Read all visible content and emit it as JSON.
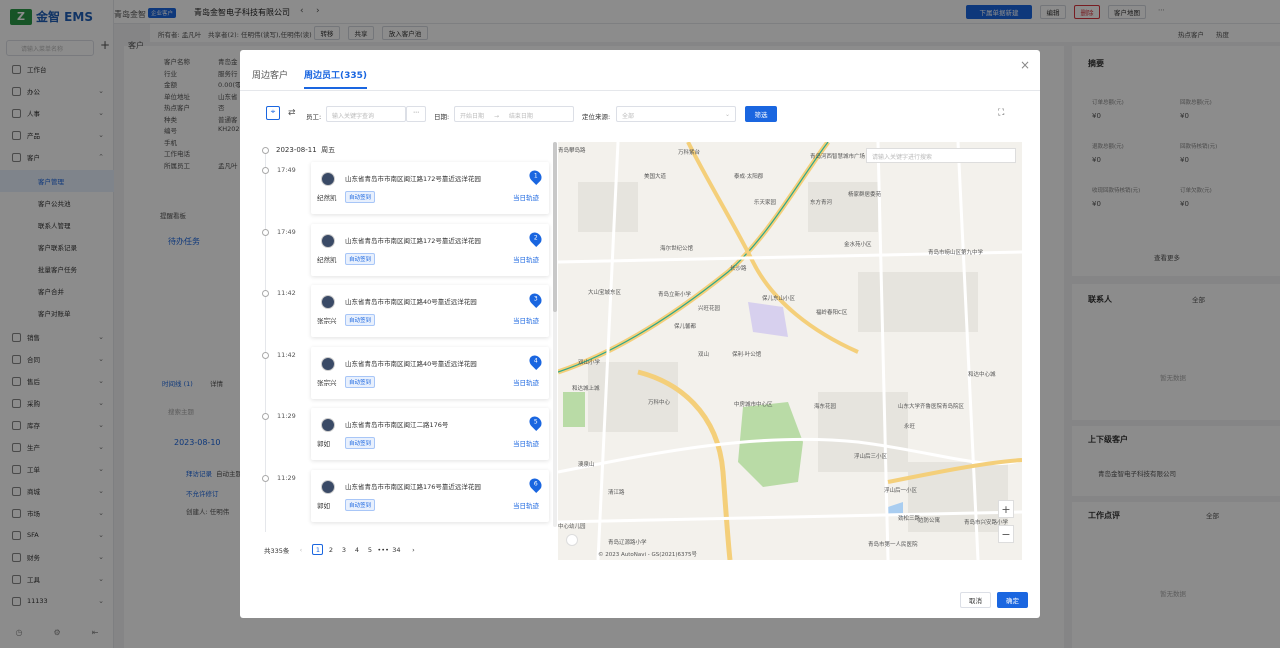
{
  "app": {
    "logo_text": "金智 EMS",
    "company_title": "青岛金智"
  },
  "sidebar": {
    "search_placeholder": "请输入菜单名称",
    "items": [
      {
        "label": "工作台"
      },
      {
        "label": "办公"
      },
      {
        "label": "人事"
      },
      {
        "label": "产品"
      },
      {
        "label": "客户"
      }
    ],
    "sub_items": [
      {
        "label": "客户管理"
      },
      {
        "label": "客户公共池"
      },
      {
        "label": "联系人管理"
      },
      {
        "label": "客户联系记录"
      },
      {
        "label": "批量客户任务"
      },
      {
        "label": "客户合并"
      },
      {
        "label": "客户对账单"
      }
    ],
    "lower_items": [
      {
        "label": "销售"
      },
      {
        "label": "合同"
      },
      {
        "label": "售后"
      },
      {
        "label": "采购"
      },
      {
        "label": "库存"
      },
      {
        "label": "生产"
      },
      {
        "label": "工单"
      },
      {
        "label": "商城"
      },
      {
        "label": "市场"
      },
      {
        "label": "SFA"
      },
      {
        "label": "财务"
      },
      {
        "label": "工具"
      },
      {
        "label": "11133"
      }
    ]
  },
  "topbar": {
    "tag": "企业客户",
    "title": "青岛金智电子科技有限公司",
    "btn_new": "下属单据新建",
    "btn_edit": "编辑",
    "btn_delete": "删除",
    "btn_map": "客户地图"
  },
  "subbar": {
    "owner": "所有者: 孟凡叶",
    "shared": "共享者(2): 任明伟(读写),任明伟(读)",
    "btn_transfer": "转移",
    "btn_share": "共享",
    "btn_pool": "放入客户池",
    "hot": "热点客户",
    "heat": "热度"
  },
  "bg": {
    "section": "客户",
    "fields": [
      "客户名称",
      "行业",
      "金额",
      "单位地址",
      "热点客户",
      "种类",
      "编号",
      "手机",
      "工作电话",
      "所属员工"
    ],
    "values": [
      "青岛金",
      "服务行",
      "0.00(零",
      "山东省",
      "否",
      "普通客",
      "KH202",
      "",
      "",
      "孟凡叶"
    ],
    "reminder": "提醒看板",
    "todo": "待办任务",
    "timeline_tab": "时间线 (1)",
    "detail_tab": "详情",
    "search_ph": "搜索主题",
    "date": "2023-08-10",
    "record": "拜访记录",
    "auto_main": "自动主题",
    "unfinished": "不允许修订",
    "creator": "创建人: 任明伟"
  },
  "right_panel": {
    "summary": "摘要",
    "stats": [
      {
        "label": "订单总额(元)",
        "value": "¥0"
      },
      {
        "label": "回款总额(元)",
        "value": "¥0"
      },
      {
        "label": "退款总额(元)",
        "value": "¥0"
      },
      {
        "label": "回款待核销(元)",
        "value": "¥0"
      },
      {
        "label": "收现回款待核销(元)",
        "value": "¥0"
      },
      {
        "label": "订单欠款(元)",
        "value": "¥0"
      }
    ],
    "more": "查看更多",
    "contacts": "联系人",
    "all": "全部",
    "empty": "暂无数据",
    "parent": "上下级客户",
    "parent_name": "青岛金智电子科技有限公司",
    "review": "工作点评"
  },
  "modal": {
    "tab1": "周边客户",
    "tab2": "周边员工(335)",
    "employee_label": "员工:",
    "employee_ph": "输入关键字查询",
    "date_label": "日期:",
    "date_start": "开始日期",
    "date_end": "结束日期",
    "source_label": "定位来源:",
    "source_value": "全部",
    "filter_btn": "筛选",
    "timeline_date": "2023-08-11",
    "timeline_weekday": "周五",
    "entries": [
      {
        "time": "17:49",
        "name": "纪然凯",
        "addr": "山东省青岛市市南区闽江路172号靠近远洋花园",
        "badge": "自动签到",
        "num": "1",
        "link": "当日轨迹"
      },
      {
        "time": "17:49",
        "name": "纪然凯",
        "addr": "山东省青岛市市南区闽江路172号靠近远洋花园",
        "badge": "自动签到",
        "num": "2",
        "link": "当日轨迹"
      },
      {
        "time": "11:42",
        "name": "张宗兴",
        "addr": "山东省青岛市市南区闽江路40号靠近远洋花园",
        "badge": "自动签到",
        "num": "3",
        "link": "当日轨迹"
      },
      {
        "time": "11:42",
        "name": "张宗兴",
        "addr": "山东省青岛市市南区闽江路40号靠近远洋花园",
        "badge": "自动签到",
        "num": "4",
        "link": "当日轨迹"
      },
      {
        "time": "11:29",
        "name": "郭如",
        "addr": "山东省青岛市市南区闽江二路176号",
        "badge": "自动签到",
        "num": "5",
        "link": "当日轨迹"
      },
      {
        "time": "11:29",
        "name": "郭如",
        "addr": "山东省青岛市市南区闽江路176号靠近远洋花园",
        "badge": "自动签到",
        "num": "6",
        "link": "当日轨迹"
      }
    ],
    "pager_total": "共335条",
    "pages": [
      "1",
      "2",
      "3",
      "4",
      "5",
      "•••",
      "34"
    ],
    "map_search_ph": "请输入关键字进行搜索",
    "map_labels": [
      "青岛攀岛路",
      "万科紫台",
      "美国大道",
      "泰成·太阳郡",
      "青岛河西智慧城市广场",
      "杨家群居委苑",
      "乐天家园",
      "东方青河",
      "海尔世纪公馆",
      "金水苑小区",
      "青岛市崂山区第九中学",
      "长沙路",
      "大山宝城东区",
      "青岛立新小学",
      "兴旺花园",
      "保儿东山小区",
      "福岭春阳C区",
      "保儿馨都",
      "保利·叶公馆",
      "双山",
      "双山小学",
      "和达城上城",
      "万科中心",
      "中房城市中心区",
      "海东花园",
      "和达中心城",
      "山东大学齐鲁医院青岛院区",
      "永旺",
      "浮山后三小区",
      "浮山后一小区",
      "劲松三路",
      "澳泉山",
      "清江路",
      "青岛市第一人民医院",
      "边防公寓",
      "青岛市兴安路小学",
      "青岛辽源路小学",
      "中心幼儿园",
      "© 2023 AutoNavi - GS(2021)6375号"
    ],
    "cancel": "取消",
    "ok": "确定"
  }
}
